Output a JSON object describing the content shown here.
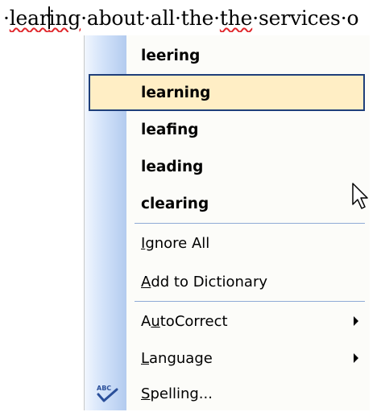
{
  "document": {
    "words": [
      "",
      "learing",
      "about",
      "all",
      "the",
      "the",
      "services",
      "o"
    ],
    "misspelled_word": "learing",
    "repeated_word": "the"
  },
  "context_menu": {
    "suggestions": [
      "leering",
      "learning",
      "leafing",
      "leading",
      "clearing"
    ],
    "selected_suggestion": "learning",
    "ignore_all": {
      "accel": "I",
      "rest": "gnore All"
    },
    "add_to_dictionary": {
      "accel": "A",
      "rest": "dd to Dictionary"
    },
    "autocorrect": {
      "pre": "A",
      "accel": "u",
      "rest": "toCorrect"
    },
    "language": {
      "accel": "L",
      "rest": "anguage"
    },
    "spelling": {
      "accel": "S",
      "rest": "pelling..."
    },
    "spelling_icon_text": "ABC"
  },
  "icons": {
    "submenu_arrow": "triangle-right",
    "spelling": "abc-check-icon",
    "pointer": "mouse-pointer-icon"
  },
  "colors": {
    "selection_fill": "#ffeec5",
    "selection_border": "#1f3f7a",
    "menu_strip": "#c6d9f5",
    "spell_underline": "#e0262b"
  }
}
